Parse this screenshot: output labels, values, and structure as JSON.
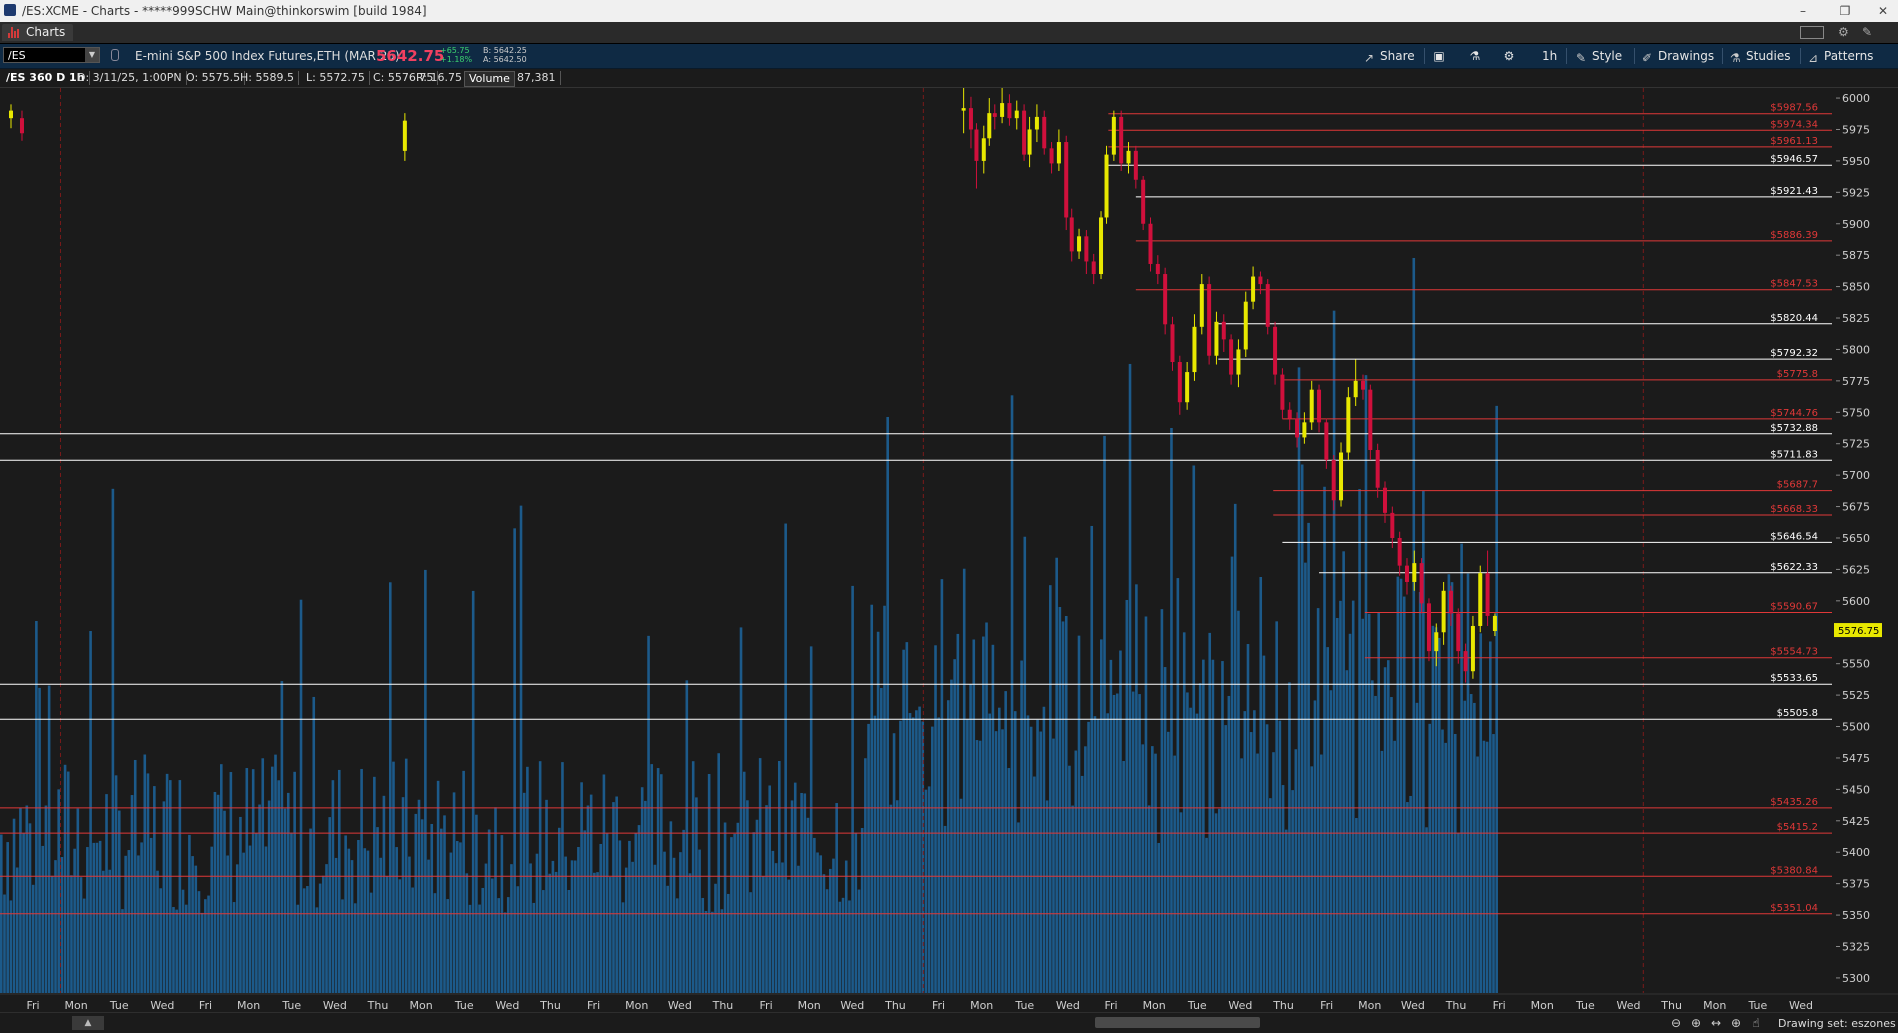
{
  "window": {
    "title": "/ES:XCME - Charts - *****999SCHW Main@thinkorswim [build 1984]",
    "controls": [
      "–",
      "❐",
      "✕"
    ]
  },
  "tabbar": {
    "tab_label": "Charts"
  },
  "toolbar": {
    "symbol": "/ES",
    "description": "E-mini S&P 500 Index Futures,ETH (MAR 25)",
    "last_price": "5642.75",
    "change": "+65.75",
    "change_pct": "+1.18%",
    "bid": "B: 5642.25",
    "ask": "A: 5642.50",
    "share_label": "Share",
    "timeframe_label": "1h",
    "style_label": "Style",
    "drawings_label": "Drawings",
    "studies_label": "Studies",
    "patterns_label": "Patterns",
    "colors": {
      "bg": "#0f2a44",
      "last_price": "#f04060",
      "change": "#3cd070"
    }
  },
  "infobar": {
    "name": "/ES 360 D 1h",
    "date": "D: 3/11/25, 1:00PN",
    "open": "O: 5575.5",
    "high": "H: 5589.5",
    "low": "L: 5572.75",
    "close": "C: 5576.75",
    "range": "R: 16.75",
    "volume_label": "Volume",
    "volume_value": "87,381"
  },
  "chart_data": {
    "type": "candlestick",
    "y_ticks": [
      6000,
      5975,
      5950,
      5925,
      5900,
      5875,
      5850,
      5825,
      5800,
      5775,
      5750,
      5725,
      5700,
      5675,
      5650,
      5625,
      5600,
      5575,
      5550,
      5525,
      5500,
      5475,
      5450,
      5425,
      5400,
      5375,
      5350,
      5325,
      5300
    ],
    "ylim": [
      5288,
      6008
    ],
    "x_labels": [
      "Fri",
      "Mon",
      "Tue",
      "Wed",
      "Fri",
      "Mon",
      "Tue",
      "Wed",
      "Thu",
      "Mon",
      "Tue",
      "Wed",
      "Thu",
      "Fri",
      "Mon",
      "Wed",
      "Thu",
      "Fri",
      "Mon",
      "Wed",
      "Thu",
      "Fri",
      "Mon",
      "Tue",
      "Wed",
      "Fri",
      "Mon",
      "Tue",
      "Wed",
      "Thu",
      "Fri",
      "Mon",
      "Wed",
      "Thu",
      "Fri",
      "Mon",
      "Tue",
      "Wed",
      "Thu",
      "Mon",
      "Tue",
      "Wed"
    ],
    "current_price": "5576.75",
    "current_price_value": 5576.75,
    "levels": [
      {
        "label": "$5987.56",
        "value": 5987.56,
        "color": "#e03838",
        "start": 0.605
      },
      {
        "label": "$5974.34",
        "value": 5974.34,
        "color": "#e03838",
        "start": 0.605
      },
      {
        "label": "$5961.13",
        "value": 5961.13,
        "color": "#e03838",
        "start": 0.605
      },
      {
        "label": "$5946.57",
        "value": 5946.57,
        "color": "#ffffff",
        "start": 0.605
      },
      {
        "label": "$5921.43",
        "value": 5921.43,
        "color": "#ffffff",
        "start": 0.62
      },
      {
        "label": "$5886.39",
        "value": 5886.39,
        "color": "#e03838",
        "start": 0.62
      },
      {
        "label": "$5847.53",
        "value": 5847.53,
        "color": "#e03838",
        "start": 0.62
      },
      {
        "label": "$5820.44",
        "value": 5820.44,
        "color": "#ffffff",
        "start": 0.665
      },
      {
        "label": "$5792.32",
        "value": 5792.32,
        "color": "#ffffff",
        "start": 0.665
      },
      {
        "label": "$5775.8",
        "value": 5775.8,
        "color": "#e03838",
        "start": 0.7
      },
      {
        "label": "$5744.76",
        "value": 5744.76,
        "color": "#e03838",
        "start": 0.7
      },
      {
        "label": "$5732.88",
        "value": 5732.88,
        "color": "#ffffff",
        "start": 0.0
      },
      {
        "label": "$5711.83",
        "value": 5711.83,
        "color": "#ffffff",
        "start": 0.0
      },
      {
        "label": "$5687.7",
        "value": 5687.7,
        "color": "#e03838",
        "start": 0.695
      },
      {
        "label": "$5668.33",
        "value": 5668.33,
        "color": "#e03838",
        "start": 0.695
      },
      {
        "label": "$5646.54",
        "value": 5646.54,
        "color": "#ffffff",
        "start": 0.7
      },
      {
        "label": "$5622.33",
        "value": 5622.33,
        "color": "#ffffff",
        "start": 0.72
      },
      {
        "label": "$5590.67",
        "value": 5590.67,
        "color": "#e03838",
        "start": 0.745
      },
      {
        "label": "$5554.73",
        "value": 5554.73,
        "color": "#e03838",
        "start": 0.745
      },
      {
        "label": "$5533.65",
        "value": 5533.65,
        "color": "#ffffff",
        "start": 0.0
      },
      {
        "label": "$5505.8",
        "value": 5505.8,
        "color": "#ffffff",
        "start": 0.0
      },
      {
        "label": "$5435.26",
        "value": 5435.26,
        "color": "#e03838",
        "start": 0.0
      },
      {
        "label": "$5415.2",
        "value": 5415.2,
        "color": "#e03838",
        "start": 0.0
      },
      {
        "label": "$5380.84",
        "value": 5380.84,
        "color": "#e03838",
        "start": 0.0
      },
      {
        "label": "$5351.04",
        "value": 5351.04,
        "color": "#e03838",
        "start": 0.0
      }
    ],
    "candles": [
      [
        0.006,
        5990,
        5984,
        5995,
        5976,
        "up"
      ],
      [
        0.012,
        5984,
        5972,
        5990,
        5966,
        "down"
      ],
      [
        0.221,
        5958,
        5982,
        5988,
        5950,
        "up"
      ],
      [
        0.526,
        5990,
        5992,
        6010,
        5972,
        "up"
      ],
      [
        0.53,
        5992,
        5975,
        6001,
        5960,
        "down"
      ],
      [
        0.533,
        5975,
        5950,
        5980,
        5928,
        "down"
      ],
      [
        0.537,
        5950,
        5968,
        5978,
        5940,
        "up"
      ],
      [
        0.54,
        5968,
        5988,
        6000,
        5962,
        "up"
      ],
      [
        0.543,
        5988,
        5985,
        5995,
        5975,
        "down"
      ],
      [
        0.547,
        5985,
        5996,
        6008,
        5980,
        "up"
      ],
      [
        0.551,
        5996,
        5984,
        6003,
        5978,
        "down"
      ],
      [
        0.555,
        5984,
        5990,
        5998,
        5975,
        "up"
      ],
      [
        0.559,
        5990,
        5955,
        5995,
        5950,
        "down"
      ],
      [
        0.562,
        5955,
        5975,
        5985,
        5945,
        "up"
      ],
      [
        0.566,
        5975,
        5985,
        5995,
        5965,
        "up"
      ],
      [
        0.57,
        5985,
        5960,
        5990,
        5955,
        "down"
      ],
      [
        0.574,
        5960,
        5948,
        5965,
        5940,
        "down"
      ],
      [
        0.578,
        5948,
        5965,
        5975,
        5942,
        "up"
      ],
      [
        0.582,
        5965,
        5905,
        5970,
        5895,
        "down"
      ],
      [
        0.585,
        5905,
        5878,
        5912,
        5870,
        "down"
      ],
      [
        0.589,
        5878,
        5890,
        5896,
        5872,
        "up"
      ],
      [
        0.593,
        5890,
        5870,
        5895,
        5860,
        "down"
      ],
      [
        0.597,
        5870,
        5860,
        5876,
        5852,
        "down"
      ],
      [
        0.601,
        5860,
        5905,
        5910,
        5856,
        "up"
      ],
      [
        0.604,
        5905,
        5955,
        5962,
        5900,
        "up"
      ],
      [
        0.608,
        5955,
        5985,
        5990,
        5950,
        "up"
      ],
      [
        0.612,
        5985,
        5948,
        5990,
        5942,
        "down"
      ],
      [
        0.616,
        5948,
        5958,
        5965,
        5940,
        "up"
      ],
      [
        0.62,
        5958,
        5935,
        5962,
        5928,
        "down"
      ],
      [
        0.624,
        5935,
        5900,
        5938,
        5895,
        "down"
      ],
      [
        0.628,
        5900,
        5868,
        5905,
        5862,
        "down"
      ],
      [
        0.632,
        5868,
        5860,
        5875,
        5852,
        "down"
      ],
      [
        0.636,
        5860,
        5820,
        5865,
        5812,
        "down"
      ],
      [
        0.64,
        5820,
        5790,
        5826,
        5783,
        "down"
      ],
      [
        0.644,
        5790,
        5758,
        5795,
        5748,
        "down"
      ],
      [
        0.648,
        5758,
        5782,
        5790,
        5752,
        "up"
      ],
      [
        0.652,
        5782,
        5818,
        5828,
        5775,
        "up"
      ],
      [
        0.656,
        5818,
        5852,
        5860,
        5812,
        "up"
      ],
      [
        0.66,
        5852,
        5795,
        5858,
        5788,
        "down"
      ],
      [
        0.664,
        5795,
        5822,
        5830,
        5788,
        "up"
      ],
      [
        0.668,
        5822,
        5808,
        5828,
        5798,
        "down"
      ],
      [
        0.672,
        5808,
        5780,
        5812,
        5772,
        "down"
      ],
      [
        0.676,
        5780,
        5800,
        5808,
        5770,
        "up"
      ],
      [
        0.68,
        5800,
        5838,
        5846,
        5794,
        "up"
      ],
      [
        0.684,
        5838,
        5858,
        5866,
        5832,
        "up"
      ],
      [
        0.688,
        5858,
        5852,
        5862,
        5844,
        "down"
      ],
      [
        0.692,
        5852,
        5818,
        5856,
        5812,
        "down"
      ],
      [
        0.696,
        5818,
        5780,
        5822,
        5772,
        "down"
      ],
      [
        0.7,
        5780,
        5752,
        5785,
        5745,
        "down"
      ],
      [
        0.704,
        5752,
        5745,
        5758,
        5736,
        "down"
      ],
      [
        0.708,
        5745,
        5730,
        5750,
        5722,
        "down"
      ],
      [
        0.712,
        5730,
        5742,
        5750,
        5725,
        "up"
      ],
      [
        0.716,
        5742,
        5768,
        5775,
        5736,
        "up"
      ],
      [
        0.72,
        5768,
        5742,
        5772,
        5734,
        "down"
      ],
      [
        0.724,
        5742,
        5712,
        5745,
        5705,
        "down"
      ],
      [
        0.728,
        5712,
        5680,
        5716,
        5672,
        "down"
      ],
      [
        0.732,
        5680,
        5718,
        5726,
        5675,
        "up"
      ],
      [
        0.736,
        5718,
        5762,
        5770,
        5712,
        "up"
      ],
      [
        0.74,
        5762,
        5775,
        5792,
        5755,
        "up"
      ],
      [
        0.744,
        5775,
        5768,
        5780,
        5760,
        "down"
      ],
      [
        0.748,
        5768,
        5720,
        5772,
        5712,
        "down"
      ],
      [
        0.752,
        5720,
        5690,
        5725,
        5682,
        "down"
      ],
      [
        0.756,
        5690,
        5670,
        5695,
        5662,
        "down"
      ],
      [
        0.76,
        5670,
        5650,
        5675,
        5642,
        "down"
      ],
      [
        0.764,
        5650,
        5628,
        5655,
        5620,
        "down"
      ],
      [
        0.768,
        5628,
        5615,
        5634,
        5605,
        "down"
      ],
      [
        0.772,
        5615,
        5630,
        5640,
        5608,
        "up"
      ],
      [
        0.776,
        5630,
        5598,
        5634,
        5590,
        "down"
      ],
      [
        0.78,
        5598,
        5560,
        5602,
        5552,
        "down"
      ],
      [
        0.784,
        5560,
        5575,
        5582,
        5548,
        "up"
      ],
      [
        0.788,
        5575,
        5608,
        5615,
        5565,
        "up"
      ],
      [
        0.792,
        5608,
        5590,
        5612,
        5580,
        "down"
      ],
      [
        0.796,
        5590,
        5560,
        5594,
        5550,
        "down"
      ],
      [
        0.8,
        5560,
        5544,
        5566,
        5535,
        "down"
      ],
      [
        0.804,
        5544,
        5580,
        5588,
        5538,
        "up"
      ],
      [
        0.808,
        5580,
        5622,
        5628,
        5575,
        "up"
      ],
      [
        0.812,
        5622,
        5588,
        5640,
        5580,
        "down"
      ],
      [
        0.816,
        5588,
        5576,
        5590,
        5572,
        "up"
      ]
    ],
    "colors": {
      "up": "#e8e800",
      "down": "#d0103c",
      "volume": "#1c5a8a",
      "background": "#1b1b1b"
    }
  },
  "statusbar": {
    "drawing_set": "Drawing set: eszones"
  }
}
